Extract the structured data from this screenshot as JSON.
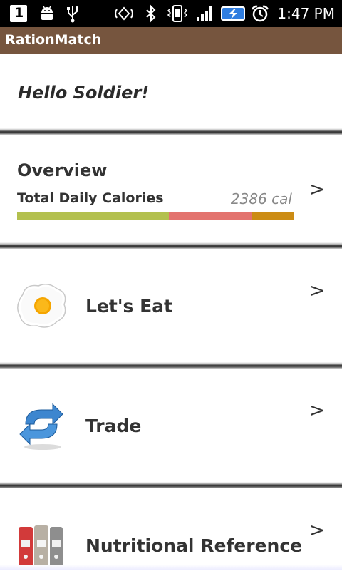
{
  "status_bar": {
    "notification_count": "1",
    "time": "1:47 PM",
    "icons": [
      "notification-icon",
      "android-debug-icon",
      "usb-icon",
      "vibrate-signal-icon",
      "bluetooth-icon",
      "vibrate-icon",
      "signal-icon",
      "battery-charging-icon",
      "alarm-icon"
    ]
  },
  "app": {
    "title": "RationMatch"
  },
  "greeting": {
    "text": "Hello Soldier!"
  },
  "overview": {
    "title": "Overview",
    "calories_label": "Total Daily Calories",
    "calories_value": "2386 cal",
    "bar_segments": [
      {
        "name": "carbs",
        "fraction": 0.55,
        "color": "#b3c04e"
      },
      {
        "name": "fat",
        "fraction": 0.3,
        "color": "#e3736e"
      },
      {
        "name": "protein",
        "fraction": 0.15,
        "color": "#cc8c14"
      }
    ],
    "chevron": ">"
  },
  "menu": {
    "items": [
      {
        "label": "Let's Eat",
        "icon": "fried-egg-icon",
        "chevron": ">"
      },
      {
        "label": "Trade",
        "icon": "refresh-arrows-icon",
        "chevron": ">"
      },
      {
        "label": "Nutritional Reference",
        "icon": "binders-icon",
        "chevron": ">"
      }
    ]
  },
  "colors": {
    "title_bar": "#76553e",
    "status_bar": "#000000",
    "text_primary": "#333333",
    "text_secondary": "#888888"
  }
}
